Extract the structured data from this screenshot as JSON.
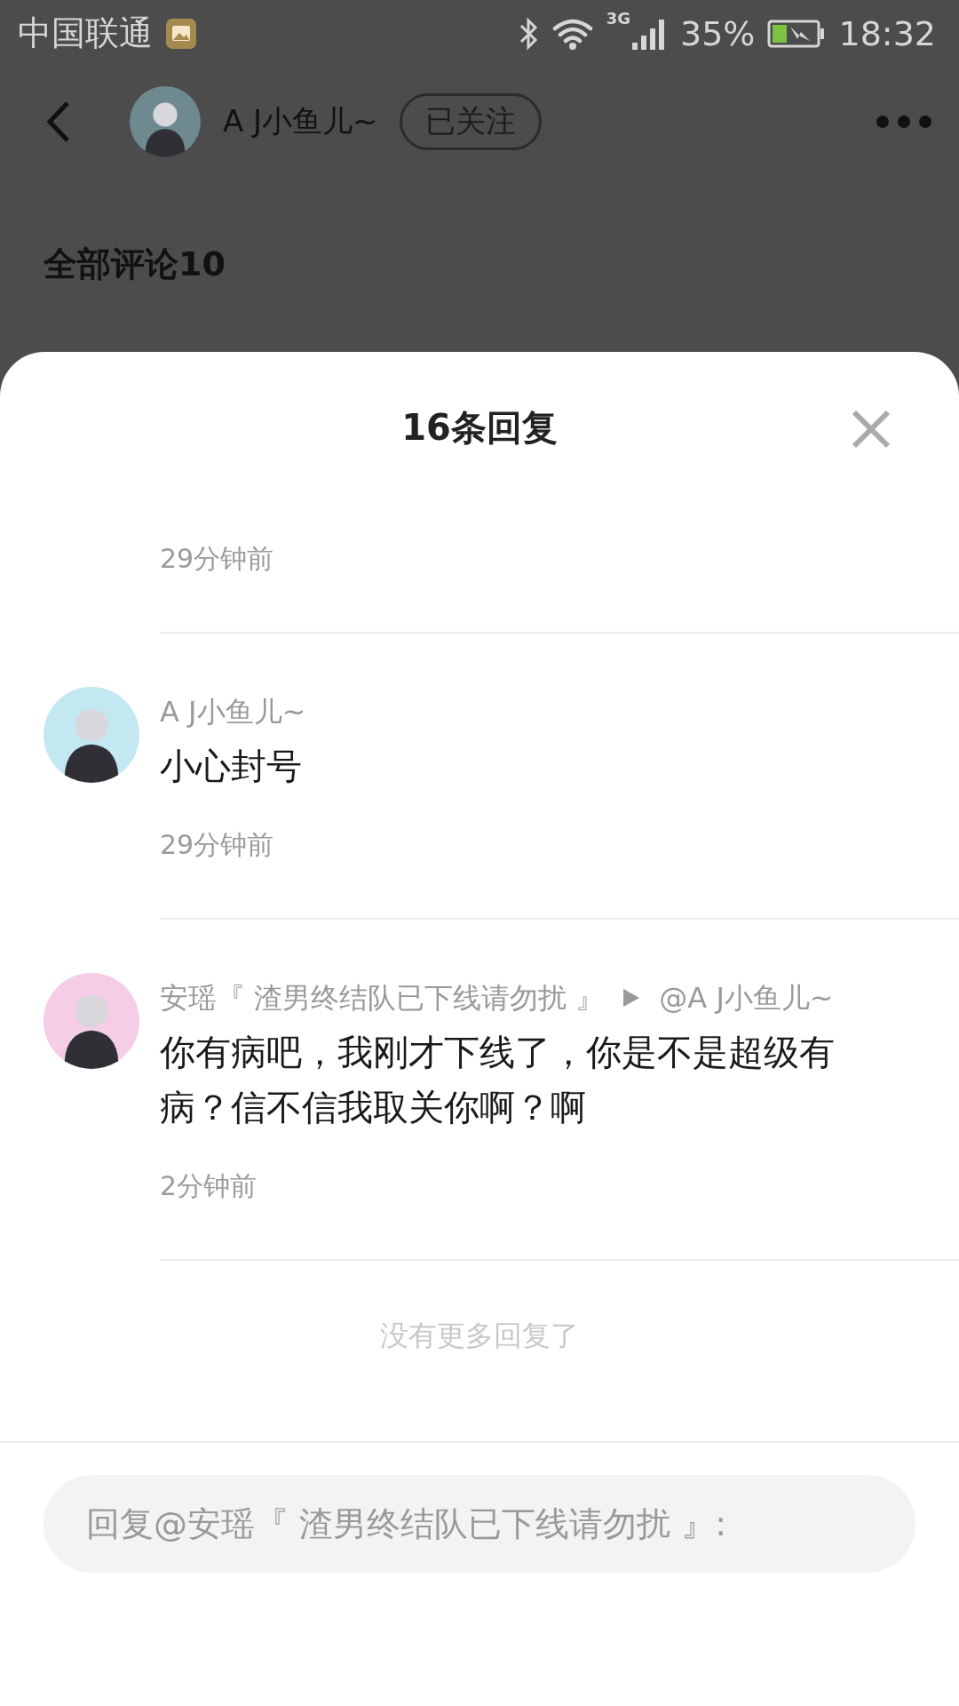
{
  "status_bar": {
    "carrier": "中国联通",
    "network": "3G",
    "battery": "35%",
    "time": "18:32"
  },
  "header": {
    "author": "A J小鱼儿~",
    "follow": "已关注",
    "followed": true
  },
  "comments_heading": "全部评论10",
  "sheet": {
    "title": "16条回复",
    "replies": [
      {
        "time": "29分钟前"
      },
      {
        "author": "A J小鱼儿~",
        "color": "#c4e8f2",
        "text": "小心封号",
        "time": "29分钟前"
      },
      {
        "author": "安瑶『 渣男终结队已下线请勿扰 』",
        "reply_to": "@A J小鱼儿~",
        "color": "#f5cde6",
        "text": "你有病吧，我刚才下线了，你是不是超级有病？信不信我取关你啊？啊",
        "time": "2分钟前"
      }
    ],
    "end_note": "没有更多回复了",
    "input": {
      "placeholder": "回复@安瑶『 渣男终结队已下线请勿扰 』:"
    }
  }
}
